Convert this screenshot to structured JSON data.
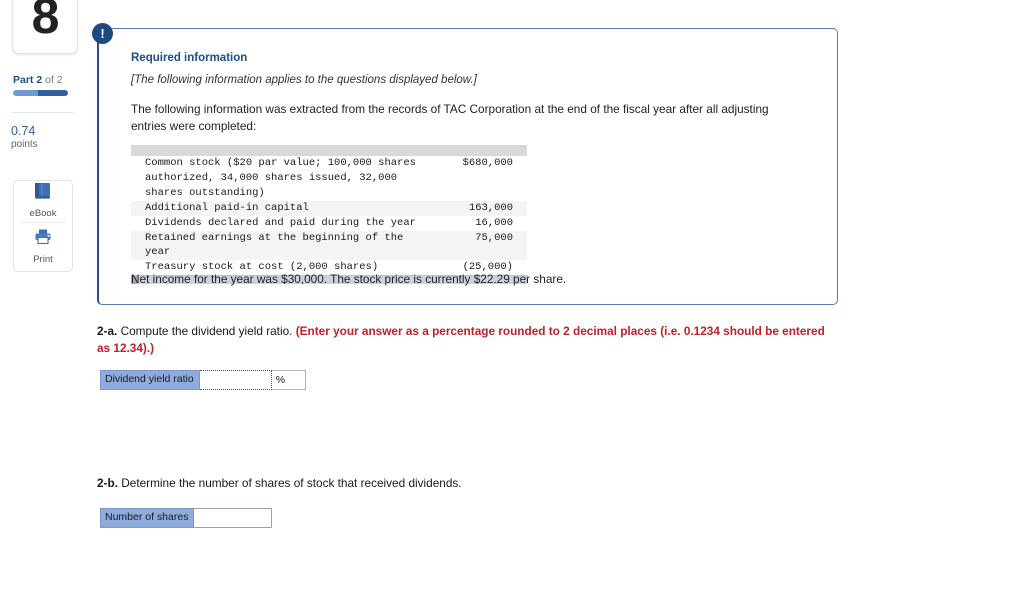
{
  "sidebar": {
    "question_number": "8",
    "part_prefix": "Part 2",
    "part_suffix": "of 2",
    "points_value": "0.74",
    "points_label": "points",
    "tools": [
      {
        "icon": "ebook-icon",
        "label": "eBook"
      },
      {
        "icon": "printer-icon",
        "label": "Print"
      }
    ],
    "accent_blue": "#2f5f9e",
    "progress_light": "#6f9ad1",
    "progress_dark": "#2f5f9e"
  },
  "info_panel": {
    "badge_icon": "exclamation-icon",
    "badge_glyph": "!",
    "title": "Required information",
    "subtitle": "[The following information applies to the questions displayed below.]",
    "body": "The following information was extracted from the records of TAC Corporation at the end of the fiscal year after all adjusting entries were completed:",
    "net_income_note": "Net income for the year was $30,000. The stock price is currently $22.29 per share.",
    "border_color": "#5a79ab",
    "title_color": "#1c4e8a"
  },
  "data_table": {
    "rows": [
      {
        "description": "Common stock ($20 par value; 100,000 shares authorized, 34,000 shares issued, 32,000 shares outstanding)",
        "amount": "$680,000"
      },
      {
        "description": "Additional paid-in capital",
        "amount": "163,000"
      },
      {
        "description": "Dividends declared and paid during the year",
        "amount": "16,000"
      },
      {
        "description": "Retained earnings at the beginning of the year",
        "amount": "75,000"
      },
      {
        "description": "Treasury stock at cost (2,000 shares)",
        "amount": "(25,000)"
      }
    ]
  },
  "questions": [
    {
      "id": "2-a",
      "label": "2-a.",
      "prompt": " Compute the dividend yield ratio. ",
      "instruction": "(Enter your answer as a percentage rounded to 2 decimal places (i.e. 0.1234 should be entered as 12.34).)",
      "answer": {
        "label": "Dividend yield ratio",
        "value": "",
        "suffix": "%"
      }
    },
    {
      "id": "2-b",
      "label": "2-b.",
      "prompt": " Determine the number of shares of stock that received dividends.",
      "instruction": "",
      "answer": {
        "label": "Number of shares",
        "value": "",
        "suffix": ""
      }
    }
  ],
  "colors": {
    "answer_label_bg": "#8faadc",
    "red_instruction": "#c02026"
  }
}
